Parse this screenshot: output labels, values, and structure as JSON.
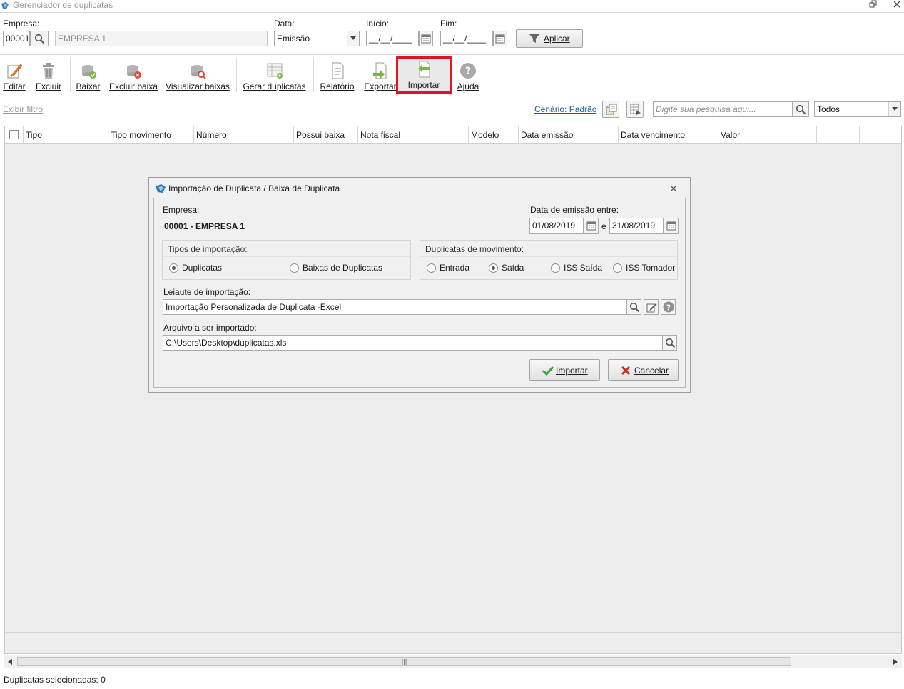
{
  "window": {
    "title": "Gerenciador de duplicatas",
    "restore_icon": "restore-icon",
    "close_icon": "close-icon"
  },
  "filters": {
    "empresa_label": "Empresa:",
    "empresa_code": "00001",
    "empresa_name": "EMPRESA 1",
    "data_label": "Data:",
    "data_value": "Emissão",
    "inicio_label": "Início:",
    "inicio_value": "__/__/____",
    "fim_label": "Fim:",
    "fim_value": "__/__/____",
    "aplicar_label": "Aplicar"
  },
  "toolbar": {
    "editar": "Editar",
    "excluir": "Excluir",
    "baixar": "Baixar",
    "excluir_baixa": "Excluir baixa",
    "visualizar_baixas": "Visualizar baixas",
    "gerar_duplicatas": "Gerar duplicatas",
    "relatorio": "Relatório",
    "exportar": "Exportar",
    "importar": "Importar",
    "ajuda": "Ajuda"
  },
  "subbar": {
    "exibir_filtro": "Exibir filtro",
    "cenario": "Cenário: Padrão",
    "search_placeholder": "Digite sua pesquisa aqui...",
    "scope_value": "Todos"
  },
  "grid": {
    "columns": [
      "Tipo",
      "Tipo movimento",
      "Número",
      "Possui baixa",
      "Nota fiscal",
      "Modelo",
      "Data emissão",
      "Data vencimento",
      "Valor"
    ]
  },
  "dialog": {
    "title": "Importação de Duplicata / Baixa de Duplicata",
    "empresa_label": "Empresa:",
    "empresa_value": "00001 - EMPRESA 1",
    "data_emissao_label": "Data de emissão entre:",
    "date_from": "01/08/2019",
    "date_sep": "e",
    "date_to": "31/08/2019",
    "tipos_title": "Tipos de importação:",
    "tipos_options": [
      "Duplicatas",
      "Baixas de Duplicatas"
    ],
    "tipos_selected": "Duplicatas",
    "movimento_title": "Duplicatas de movimento:",
    "movimento_options": [
      "Entrada",
      "Saída",
      "ISS Saída",
      "ISS Tomador"
    ],
    "movimento_selected": "Saída",
    "leiaute_label": "Leiaute de importação:",
    "leiaute_value": "Importação Personalizada de Duplicata -Excel",
    "arquivo_label": "Arquivo a ser importado:",
    "arquivo_value": "C:\\Users\\Desktop\\duplicatas.xls",
    "importar_button": "Importar",
    "cancelar_button": "Cancelar"
  },
  "status": {
    "text": "Duplicatas selecionadas: 0"
  },
  "colors": {
    "highlight": "#e2141d",
    "link": "#1f5da8",
    "ok_green": "#3ea33e",
    "cancel_red": "#c8321e"
  }
}
